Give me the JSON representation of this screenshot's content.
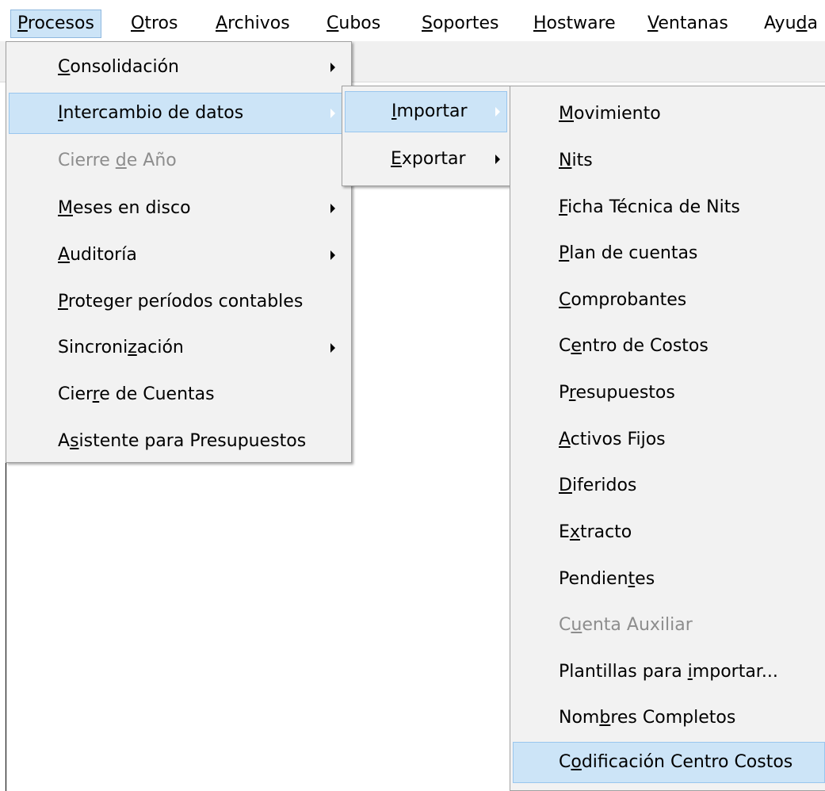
{
  "menubar": {
    "items": [
      {
        "pre": "",
        "u": "P",
        "post": "rocesos"
      },
      {
        "pre": "",
        "u": "O",
        "post": "tros"
      },
      {
        "pre": "",
        "u": "A",
        "post": "rchivos"
      },
      {
        "pre": "",
        "u": "C",
        "post": "ubos"
      },
      {
        "pre": "",
        "u": "S",
        "post": "oportes"
      },
      {
        "pre": "",
        "u": "H",
        "post": "ostware"
      },
      {
        "pre": "",
        "u": "V",
        "post": "entanas"
      },
      {
        "pre": "Ayu",
        "u": "d",
        "post": "a"
      }
    ]
  },
  "procesos_menu": {
    "items": [
      {
        "pre": "",
        "u": "C",
        "post": "onsolidación"
      },
      {
        "pre": "",
        "u": "I",
        "post": "ntercambio de datos"
      },
      {
        "pre": "Cierre ",
        "u": "d",
        "post": "e Año"
      },
      {
        "pre": "",
        "u": "M",
        "post": "eses en disco"
      },
      {
        "pre": "",
        "u": "A",
        "post": "uditoría"
      },
      {
        "pre": "",
        "u": "P",
        "post": "roteger períodos contables"
      },
      {
        "pre": "Sincroni",
        "u": "z",
        "post": "ación"
      },
      {
        "pre": "Cier",
        "u": "r",
        "post": "e de Cuentas"
      },
      {
        "pre": "A",
        "u": "s",
        "post": "istente para Presupuestos"
      }
    ]
  },
  "intercambio_menu": {
    "items": [
      {
        "pre": "",
        "u": "I",
        "post": "mportar"
      },
      {
        "pre": "",
        "u": "E",
        "post": "xportar"
      }
    ]
  },
  "importar_menu": {
    "items": [
      {
        "pre": "",
        "u": "M",
        "post": "ovimiento"
      },
      {
        "pre": "",
        "u": "N",
        "post": "its"
      },
      {
        "pre": "",
        "u": "F",
        "post": "icha Técnica de Nits"
      },
      {
        "pre": "",
        "u": "P",
        "post": "lan de cuentas"
      },
      {
        "pre": "",
        "u": "C",
        "post": "omprobantes"
      },
      {
        "pre": "C",
        "u": "e",
        "post": "ntro de Costos"
      },
      {
        "pre": "P",
        "u": "r",
        "post": "esupuestos"
      },
      {
        "pre": "",
        "u": "A",
        "post": "ctivos Fijos"
      },
      {
        "pre": "",
        "u": "D",
        "post": "iferidos"
      },
      {
        "pre": "E",
        "u": "x",
        "post": "tracto"
      },
      {
        "pre": "Pendien",
        "u": "t",
        "post": "es"
      },
      {
        "pre": "C",
        "u": "u",
        "post": "enta Auxiliar"
      },
      {
        "pre": "Plantillas para ",
        "u": "i",
        "post": "mportar..."
      },
      {
        "pre": "Nom",
        "u": "b",
        "post": "res Completos"
      },
      {
        "pre": "C",
        "u": "o",
        "post": "dificación Centro Costos"
      }
    ]
  }
}
